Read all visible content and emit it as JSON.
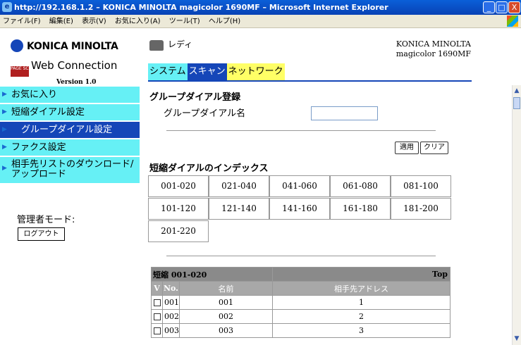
{
  "window": {
    "title": "http://192.168.1.2 – KONICA MINOLTA magicolor 1690MF – Microsoft Internet Explorer",
    "controls": {
      "minimize": "_",
      "maximize": "□",
      "close": "X"
    }
  },
  "menu": [
    "ファイル(F)",
    "編集(E)",
    "表示(V)",
    "お気に入り(A)",
    "ツール(T)",
    "ヘルプ(H)"
  ],
  "sidebar": {
    "logo_km": "KONICA MINOLTA",
    "logo_ps_badge": "PAGE SCOPE",
    "logo_ps_text": "Web Connection",
    "version": "Version 1.0",
    "nav": [
      {
        "label": "お気に入り",
        "active": false
      },
      {
        "label": "短縮ダイアル設定",
        "active": false
      },
      {
        "label": "グループダイアル設定",
        "active": true
      },
      {
        "label": "ファクス設定",
        "active": false
      },
      {
        "label": "相手先リストのダウンロード/アップロード",
        "active": false
      }
    ],
    "admin_label": "管理者モード:",
    "logout": "ログアウト"
  },
  "header": {
    "status": "レディ",
    "brand_line1": "KONICA MINOLTA",
    "brand_line2": "magicolor 1690MF",
    "tabs": [
      "システム",
      "スキャン",
      "ネットワーク"
    ],
    "active_tab": "スキャン"
  },
  "form": {
    "section_title": "グループダイアル登録",
    "group_name_label": "グループダイアル名",
    "group_name_value": "",
    "apply": "適用",
    "clear": "クリア"
  },
  "index": {
    "title": "短縮ダイアルのインデックス",
    "ranges": [
      "001-020",
      "021-040",
      "041-060",
      "061-080",
      "081-100",
      "101-120",
      "121-140",
      "141-160",
      "161-180",
      "181-200",
      "201-220"
    ]
  },
  "list": {
    "title": "短縮 001-020",
    "top_link": "Top",
    "columns": {
      "v": "V",
      "no": "No.",
      "name": "名前",
      "address": "相手先アドレス"
    },
    "rows": [
      {
        "no": "001",
        "name": "001",
        "address": "1"
      },
      {
        "no": "002",
        "name": "002",
        "address": "2"
      },
      {
        "no": "003",
        "name": "003",
        "address": "3"
      }
    ]
  },
  "colors": {
    "accent": "#1546b8",
    "cyan": "#66f0f5",
    "yellow": "#ffff66"
  }
}
